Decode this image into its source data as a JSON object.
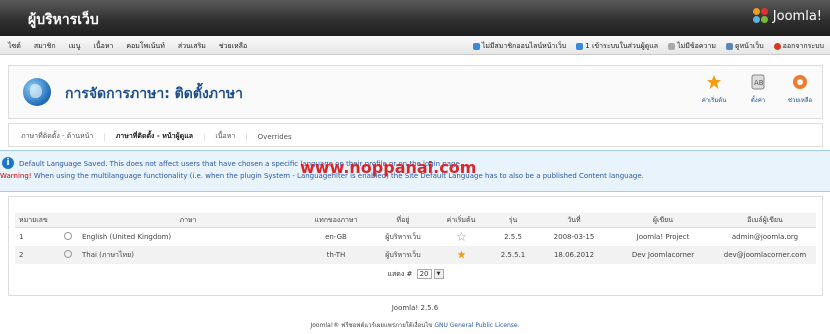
{
  "header": {
    "site_title": "ผู้บริหารเว็บ",
    "logo_text": "Joomla!"
  },
  "menu": {
    "items": [
      "ไซต์",
      "สมาชิก",
      "เมนู",
      "เนื้อหา",
      "คอมโพเน้นท์",
      "ส่วนเสริม",
      "ช่วยเหลือ"
    ],
    "status": {
      "no_message": "ไม่มีสมาชิกออนไลน์หน้าเว็บ",
      "online_admin": "1 เข้าระบบในส่วนผู้ดูแล",
      "no_mail": "ไม่มีข้อความ",
      "view_site": "ดูหน้าเว็บ",
      "logout": "ออกจากระบบ"
    }
  },
  "toolbar": {
    "title": "การจัดการภาษา: ติดตั้งภาษา",
    "default_label": "ค่าเริ่มต้น",
    "options_label": "ตั้งค่า",
    "help_label": "ช่วยเหลือ"
  },
  "tabs": [
    "ภาษาที่ติดตั้ง - ด้านหน้า",
    "ภาษาที่ติดตั้ง - หน้าผู้ดูแล",
    "เนื้อหา",
    "Overrides"
  ],
  "messages": {
    "saved": "Default Language Saved. This does not affect users that have chosen a specific language on their profile or on the login page.",
    "warning_label": "Warning!",
    "warning": "When using the multilanguage functionality (i.e. when the plugin System - Languagefilter is enabled) the Site Default Language has to also be a published Content language."
  },
  "watermark": "www.noppanai.com",
  "table": {
    "headers": [
      "หมายเลข",
      "",
      "ภาษา",
      "แทกของภาษา",
      "ที่อยู่",
      "ค่าเริ่มต้น",
      "รุ่น",
      "วันที่",
      "ผู้เขียน",
      "อีเมล์ผู้เขียน"
    ],
    "rows": [
      [
        "1",
        "",
        "English (United Kingdom)",
        "en-GB",
        "ผู้บริหารเว็บ",
        "",
        "2.5.5",
        "2008-03-15",
        "Joomla! Project",
        "admin@joomla.org"
      ],
      [
        "2",
        "",
        "Thai (ภาษาไทย)",
        "th-TH",
        "ผู้บริหารเว็บ",
        "",
        "2.5.5.1",
        "18.06.2012",
        "Dev Joomlacorner",
        "dev@joomlacorner.com"
      ]
    ],
    "default_row": 2
  },
  "pager": {
    "label": "แสดง #",
    "value": "20"
  },
  "footer": {
    "version": "Joomla! 2.5.6",
    "license_prefix": "Joomla!® ฟรีซอฟต์แวร์เผยแพร่ภายใต้เงื่อนไข",
    "license_link": "GNU General Public License."
  },
  "colors": {
    "accent": "#1f4f8a",
    "warning": "#cc0000",
    "watermark": "#d9262a",
    "star_on": "#f39c12"
  }
}
